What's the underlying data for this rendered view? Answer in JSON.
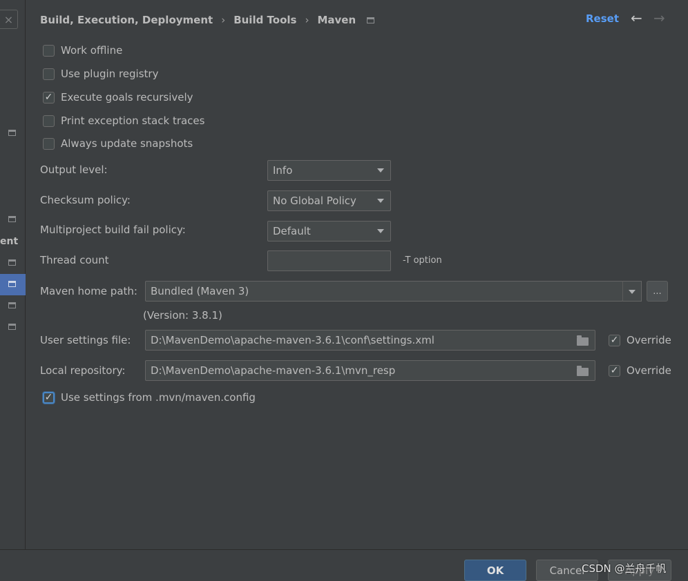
{
  "sidebar": {
    "close_glyph": "×",
    "partial_label": "ent"
  },
  "breadcrumb": {
    "items": [
      "Build, Execution, Deployment",
      "Build Tools",
      "Maven"
    ],
    "separator": "›"
  },
  "header": {
    "reset_label": "Reset",
    "back_glyph": "←",
    "forward_glyph": "→"
  },
  "options": [
    {
      "label": "Work offline",
      "checked": false
    },
    {
      "label": "Use plugin registry",
      "checked": false
    },
    {
      "label": "Execute goals recursively",
      "checked": true
    },
    {
      "label": "Print exception stack traces",
      "checked": false
    },
    {
      "label": "Always update snapshots",
      "checked": false
    }
  ],
  "form": {
    "output_level": {
      "label": "Output level:",
      "value": "Info"
    },
    "checksum_policy": {
      "label": "Checksum policy:",
      "value": "No Global Policy"
    },
    "multiproject_policy": {
      "label": "Multiproject build fail policy:",
      "value": "Default"
    },
    "thread_count": {
      "label": "Thread count",
      "value": "",
      "hint": "-T option"
    },
    "maven_home": {
      "label": "Maven home path:",
      "value": "Bundled (Maven 3)",
      "browse_label": "...",
      "version": "(Version: 3.8.1)"
    },
    "user_settings": {
      "label": "User settings file:",
      "value": "D:\\MavenDemo\\apache-maven-3.6.1\\conf\\settings.xml",
      "override_label": "Override",
      "override_checked": true
    },
    "local_repo": {
      "label": "Local repository:",
      "value": "D:\\MavenDemo\\apache-maven-3.6.1\\mvn_resp",
      "override_label": "Override",
      "override_checked": true
    },
    "mvn_config": {
      "label": "Use settings from .mvn/maven.config",
      "checked": true
    }
  },
  "footer": {
    "ok_label": "OK",
    "cancel_label": "Cancel",
    "apply_label": "Apply"
  },
  "watermark": "CSDN @兰舟千帆",
  "colors": {
    "background": "#3c3f41",
    "accent_link": "#589df6",
    "selection": "#4b6eaf",
    "ok_button": "#365880"
  }
}
